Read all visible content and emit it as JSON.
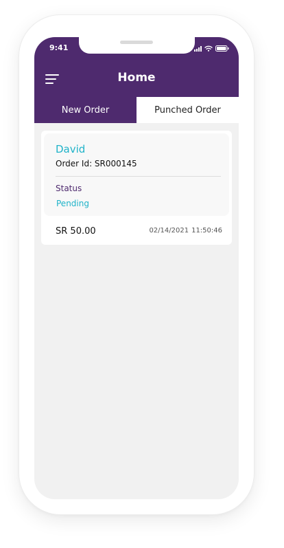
{
  "status_bar": {
    "time": "9:41"
  },
  "header": {
    "title": "Home",
    "menu_icon": "hamburger-menu-icon"
  },
  "tabs": [
    {
      "label": "New Order",
      "active": true
    },
    {
      "label": "Punched Order",
      "active": false
    }
  ],
  "order": {
    "customer_name": "David",
    "order_id": "Order Id: SR000145",
    "status_label": "Status",
    "status_value": "Pending",
    "amount": "SR 50.00",
    "date": "02/14/2021",
    "time": "11:50:46"
  },
  "colors": {
    "primary": "#4e2a6e",
    "accent": "#1fb3c9",
    "background": "#f1f1f1"
  }
}
